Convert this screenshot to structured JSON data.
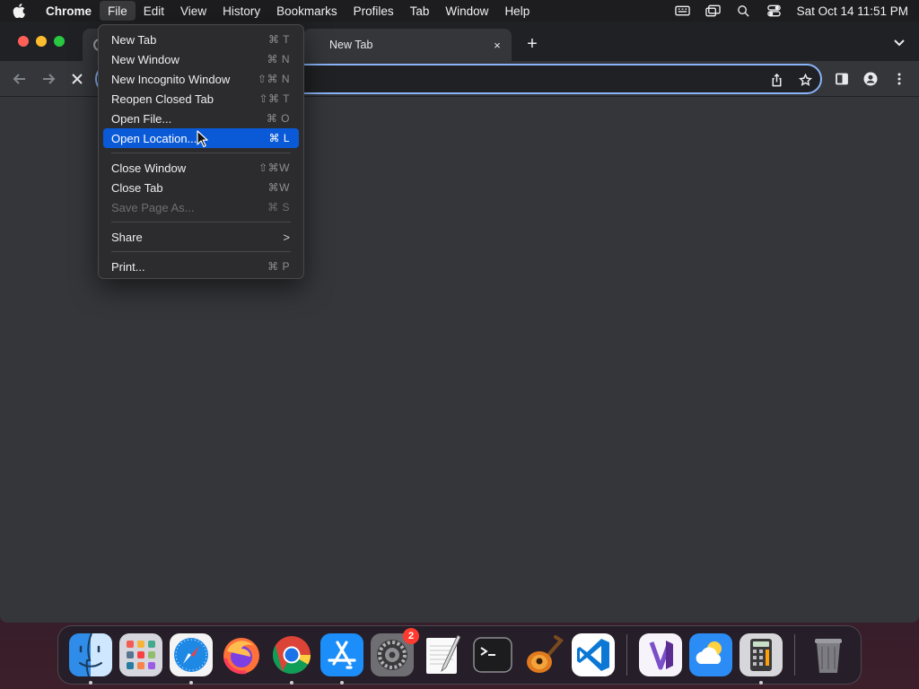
{
  "menubar": {
    "app_name": "Chrome",
    "items": [
      "File",
      "Edit",
      "View",
      "History",
      "Bookmarks",
      "Profiles",
      "Tab",
      "Window",
      "Help"
    ],
    "active_item": "File",
    "clock": "Sat Oct 14  11:51 PM",
    "status_icons": [
      "keyboard-input-icon",
      "screen-mirroring-icon",
      "spotlight-search-icon",
      "control-center-icon"
    ]
  },
  "browser": {
    "tabs": [
      {
        "title": "",
        "favicon": "loading-icon"
      },
      {
        "title": "New Tab",
        "close": "×"
      }
    ],
    "new_tab": "+",
    "accent": "#8ab4f8"
  },
  "file_menu": {
    "groups": [
      [
        {
          "label": "New Tab",
          "shortcut": "⌘ T"
        },
        {
          "label": "New Window",
          "shortcut": "⌘ N"
        },
        {
          "label": "New Incognito Window",
          "shortcut": "⇧⌘ N"
        },
        {
          "label": "Reopen Closed Tab",
          "shortcut": "⇧⌘ T"
        },
        {
          "label": "Open File...",
          "shortcut": "⌘ O"
        },
        {
          "label": "Open Location...",
          "shortcut": "⌘ L",
          "highlighted": true
        }
      ],
      [
        {
          "label": "Close Window",
          "shortcut": "⇧⌘W"
        },
        {
          "label": "Close Tab",
          "shortcut": "⌘W"
        },
        {
          "label": "Save Page As...",
          "shortcut": "⌘ S",
          "disabled": true
        }
      ],
      [
        {
          "label": "Share",
          "submenu": ">"
        }
      ],
      [
        {
          "label": "Print...",
          "shortcut": "⌘ P"
        }
      ]
    ],
    "highlight_color": "#0a5ad8"
  },
  "dock": {
    "apps": [
      {
        "name": "Finder",
        "icon": "finder-icon",
        "running": true
      },
      {
        "name": "Launchpad",
        "icon": "launchpad-icon",
        "running": false
      },
      {
        "name": "Safari",
        "icon": "safari-icon",
        "running": true
      },
      {
        "name": "Firefox",
        "icon": "firefox-icon",
        "running": false
      },
      {
        "name": "Google Chrome",
        "icon": "chrome-icon",
        "running": true
      },
      {
        "name": "App Store",
        "icon": "app-store-icon",
        "running": true
      },
      {
        "name": "System Settings",
        "icon": "system-settings-icon",
        "running": false,
        "badge": "2"
      },
      {
        "name": "TextEdit",
        "icon": "textedit-icon",
        "running": false
      },
      {
        "name": "Terminal",
        "icon": "terminal-icon",
        "running": false
      },
      {
        "name": "GarageBand",
        "icon": "garageband-icon",
        "running": false
      },
      {
        "name": "Visual Studio Code",
        "icon": "vscode-icon",
        "running": false
      },
      {
        "name": "Visual Studio",
        "icon": "visual-studio-icon",
        "running": false
      },
      {
        "name": "Weather",
        "icon": "weather-icon",
        "running": false
      },
      {
        "name": "Calculator",
        "icon": "calculator-icon",
        "running": true
      },
      {
        "name": "Trash",
        "icon": "trash-icon",
        "running": false
      }
    ]
  }
}
